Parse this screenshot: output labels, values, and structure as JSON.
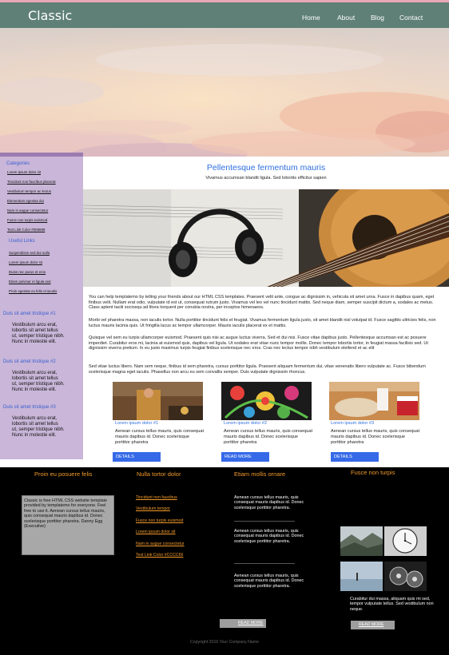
{
  "header": {
    "logo": "Classic",
    "nav": [
      "Home",
      "About",
      "Blog",
      "Contact"
    ]
  },
  "sidebar": {
    "categories_title": "Categories",
    "categories": [
      "Lorem ipsum dolor sit",
      "Tincidunt non faucibus placerat",
      "Vestibulum tempor ac lectus",
      "Elementum egestas dui",
      "Nam in augue consectetur",
      "Fusce non turpis euismod",
      "Text Link Color #006699"
    ],
    "useful_title": "Useful Links",
    "useful_links": [
      "Suspendisse sed dui nulla",
      "Lorem ipsum dolor sit",
      "Duiss nec purus et eros",
      "Etiam pulvinar et ligula sed",
      "Proin egestas eu felis et iaculis"
    ],
    "sections": [
      {
        "title": "Duis sit amet tristique #1",
        "text": "Vestibulum arcu erat, lobortis sit amet tellus ut, semper tristique nibh. Nunc in molestie elit."
      },
      {
        "title": "Duis sit amet tristique #2",
        "text": "Vestibulum arcu erat, lobortis sit amet tellus ut, semper tristique nibh. Nunc in molestie elit."
      },
      {
        "title": "Duis sit amet tristique #3",
        "text": "Vestibulum arcu erat, lobortis sit amet tellus ut, semper tristique nibh. Nunc in molestie elit."
      }
    ]
  },
  "main": {
    "title": "Pellentesque fermentum mauris",
    "subtitle": "Vivamus accumsan blandit ligula. Sed lobortis efficitur sapien",
    "paragraphs": [
      "You can help templatemo by telling your friends about our HTML CSS templates. Praesent velit ante, congue ac dignissim in, vehicula sit amet urna. Fusce in dapibus quam, eget finibus velit. Nullam erat odio, vulputate id est ut, consequat rutrum justo. Vivamus vel leo vel nunc tincidunt mattis. Sed neque diam, semper suscipit dictum a, sodales ac metus. Class aptent taciti sociosqu ad litora torquent per conubia nostra, per inceptos himenaeos.",
      "Morbi vel pharetra massa, non iaculis tortor. Nulla porttitor tincidunt felis et feugiat. Vivamus fermentum ligula justo, sit amet blandit nisl volutpat id. Fusce sagittis ultricies felis, non luctus mauris lacinia quis. Ut fringilla lacus ac tempor ullamcorper. Mauris iaculis placerat ex et mattis.",
      "Quisque vel sem eu turpis ullamcorper euismod. Praesent quis nisi ac augue luctus viverra. Sed et dui nisi. Fusce vitae dapibus justo. Pellentesque accumsan est ac posuere imperdiet. Curabitur eros mi, lacinia at euismod quis, dapibus vel ligula. Ut sodales erat vitae nunc tempor mollis. Donec tempor lobortis tortor, in feugiat massa facilisis sed. Ut dignissim viverra pretium. In eu justo maximus turpis feugiat finibus scelerisque nec eros. Cras nec lectus tempor nibh vestibulum eleifend et ac elit",
      "Sed vitae luctus libero. Nam sem neque, finibus id sem pharetra, cursus porttitor ligula. Praesent aliquam fermentum dui, vitae venenatis libero vulputate ac. Fusce bibendum scelerisque magna eget iaculis. Phasellus non arcu eu sem convallis semper. Duis vulputate dignissim rhoncus."
    ],
    "cards": [
      {
        "title": "Lorem ipsum dolor #1",
        "text": "Aenean cursus tellus mauris, quis consequat mauris dapibus id. Donec scelerisque porttitor pharetra",
        "button": "DETAILS"
      },
      {
        "title": "Lorem ipsum dolor #2",
        "text": "Aenean cursus tellus mauris, quis consequat mauris dapibus id. Donec scelerisque porttitor pharetra",
        "button": "READ MORE"
      },
      {
        "title": "Lorem ipsum dolor #3",
        "text": "Aenean cursus tellus mauris, quis consequat mauris dapibus id. Donec scelerisque porttitor pharetra",
        "button": "DETAILS"
      }
    ]
  },
  "footer": {
    "col1": {
      "title": "Proin eu posuere felis",
      "text": "Classic is free HTML CSS website template provided by templatemo for everyone. Feel free to use it. Aenean cursus tellus mauris, quis consequat mauris dapibus id. Donec scelerisque porttitor pharetra. Danny Egg (Executive)"
    },
    "col2": {
      "title": "Nulla tortor dolor",
      "links": [
        "Tincidunt non faucibus",
        "Vestibulum tempor",
        "Fusce non turpis euismod",
        "Lorem ipsum dolor sit",
        "Nam in augue consectetur",
        "Text Link Color #CCCC66"
      ]
    },
    "col3": {
      "title": "Etiam mollis ornare",
      "items": [
        "Aenean cursus tellus mauris, quis consequat mauris dapibus id. Donec scelerisque porttitor pharetra.",
        "Aenean cursus tellus mauris, quis consequat mauris dapibus id. Donec scelerisque porttitor pharetra.",
        "Aenean cursus tellus mauris, quis consequat mauris dapibus id. Donec scelerisque porttitor pharetra."
      ],
      "button": "READ MORE"
    },
    "col4": {
      "title": "Fusce non turpis",
      "text": "Curabitur dui massa, aliquam quis mi sed, tempor vulputate tellus. Sed vestibulum non neque.",
      "button": "READ MORE"
    },
    "copyright": "Copyright 2016 Your Company Name"
  },
  "colors": {
    "header": "#5f8076",
    "accent_blue": "#2f6fe0",
    "sidebar": "#c9b6d8",
    "footer_heading": "#f39a2a",
    "button": "#3569e8"
  }
}
